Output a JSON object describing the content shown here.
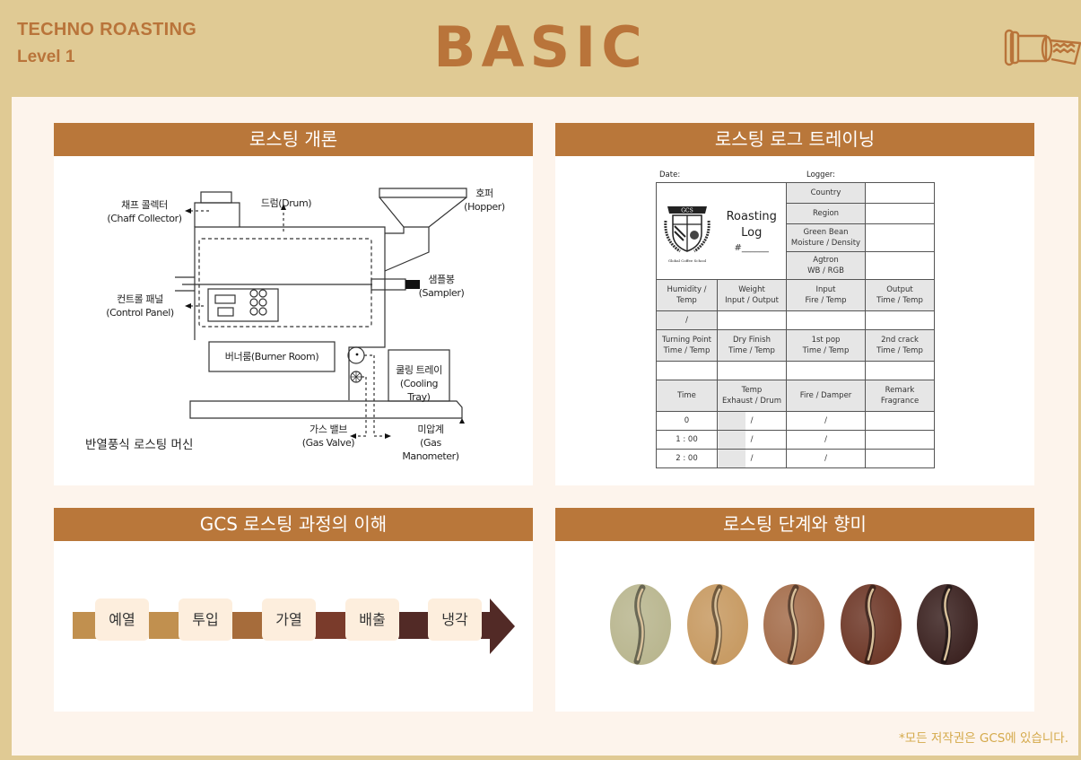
{
  "header": {
    "course": "TECHNO ROASTING",
    "level": "Level 1",
    "title": "BASIC",
    "icon": "roaster-drum-icon"
  },
  "colors": {
    "background": "#e0ca94",
    "accent": "#b9773a",
    "panel": "#fdf4ec",
    "footer_text": "#d4a94a"
  },
  "sections": {
    "overview": {
      "title": "로스팅 개론",
      "caption": "반열풍식 로스팅 머신",
      "labels": {
        "chaff_ko": "채프 콜렉터",
        "chaff_en": "(Chaff  Collector)",
        "drum": "드럼(Drum)",
        "hopper_ko": "호퍼",
        "hopper_en": "(Hopper)",
        "sampler_ko": "샘플봉",
        "sampler_en": "(Sampler)",
        "control_ko": "컨트롤 패널",
        "control_en": "(Control  Panel)",
        "burner": "버너룸(Burner Room)",
        "cooling_ko": "쿨링 트레이",
        "cooling_en": "(Cooling Tray)",
        "gasvalve_ko": "가스 밸브",
        "gasvalve_en": "(Gas Valve)",
        "manometer_ko": "미압계",
        "manometer_en": "(Gas Manometer)"
      }
    },
    "log": {
      "title": "로스팅 로그 트레이닝",
      "date_label": "Date:",
      "logger_label": "Logger:",
      "logo_text": "GCS",
      "logo_caption": "Global Coffee School",
      "log_title_1": "Roasting",
      "log_title_2": "Log",
      "log_number": "#______",
      "info_rows": [
        "Country",
        "Region",
        "Green Bean\nMoisture / Density",
        "Agtron\nWB / RGB"
      ],
      "row1_headers": [
        "Humidity /\nTemp",
        "Weight\nInput / Output",
        "Input\nFire / Temp",
        "Output\nTime / Temp"
      ],
      "row1_values": [
        "/",
        "",
        "",
        ""
      ],
      "row2_headers": [
        "Turning Point\nTime / Temp",
        "Dry Finish\nTime / Temp",
        "1st pop\nTime / Temp",
        "2nd crack\nTime / Temp"
      ],
      "row2_values": [
        "",
        "",
        "",
        ""
      ],
      "time_headers": [
        "Time",
        "Temp\nExhaust / Drum",
        "Fire / Damper",
        "Remark\nFragrance"
      ],
      "time_rows": [
        {
          "time": "0",
          "temp": "/",
          "fire": "/",
          "remark": ""
        },
        {
          "time": "1 : 00",
          "temp": "/",
          "fire": "/",
          "remark": ""
        },
        {
          "time": "2 : 00",
          "temp": "/",
          "fire": "/",
          "remark": ""
        }
      ]
    },
    "process": {
      "title": "GCS 로스팅 과정의 이해",
      "steps": [
        "예열",
        "투입",
        "가열",
        "배출",
        "냉각"
      ],
      "segment_colors": [
        "#c1904f",
        "#c1904f",
        "#a66c3b",
        "#7a3b2b",
        "#522a26"
      ]
    },
    "stages": {
      "title": "로스팅 단계와 향미",
      "beans": [
        {
          "name": "green",
          "color": "#b9b68f"
        },
        {
          "name": "light",
          "color": "#c79a62"
        },
        {
          "name": "medium",
          "color": "#a46d4b"
        },
        {
          "name": "medium-dark",
          "color": "#6e3828"
        },
        {
          "name": "dark",
          "color": "#3b2220"
        }
      ]
    }
  },
  "footer": {
    "copyright": "*모든 저작권은 GCS에 있습니다."
  }
}
